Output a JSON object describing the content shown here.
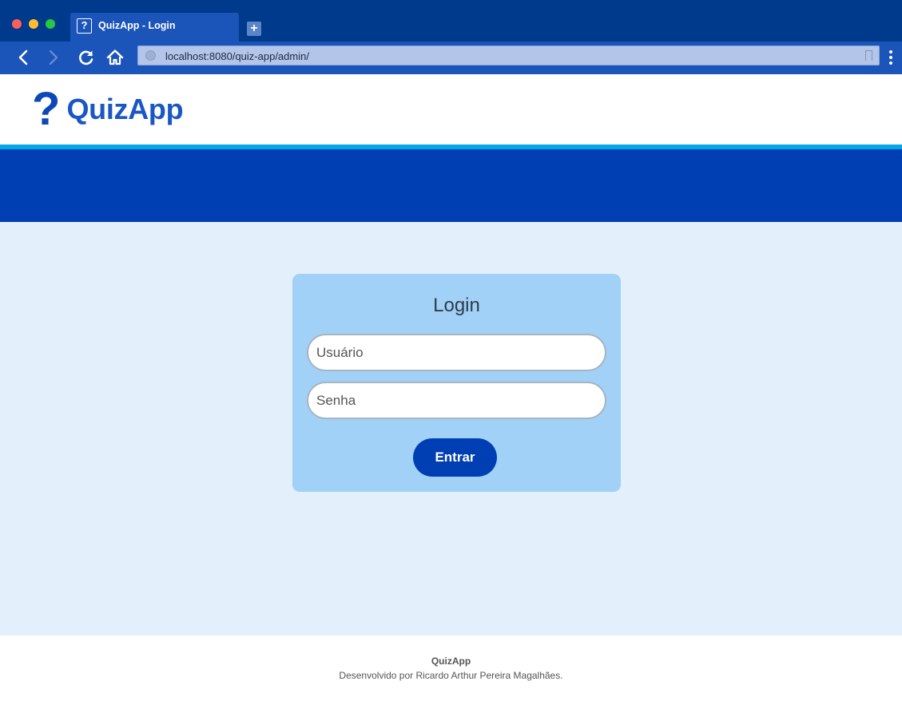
{
  "browser": {
    "tab_title": "QuizApp - Login",
    "tab_favicon": "?",
    "new_tab_icon": "plus-icon",
    "url": "localhost:8080/quiz-app/admin/"
  },
  "header": {
    "logo_mark": "?",
    "logo_text": "QuizApp"
  },
  "login": {
    "title": "Login",
    "username_placeholder": "Usuário",
    "password_placeholder": "Senha",
    "submit_label": "Entrar"
  },
  "footer": {
    "title": "QuizApp",
    "credit": "Desenvolvido por Ricardo Arthur Pereira Magalhães."
  },
  "colors": {
    "chrome_dark": "#003a8c",
    "chrome_tab": "#1b55b9",
    "brand_blue": "#003eb3",
    "accent_cyan": "#00a8e8",
    "page_bg": "#e3f0fb",
    "card_bg": "#a1d1f7"
  }
}
